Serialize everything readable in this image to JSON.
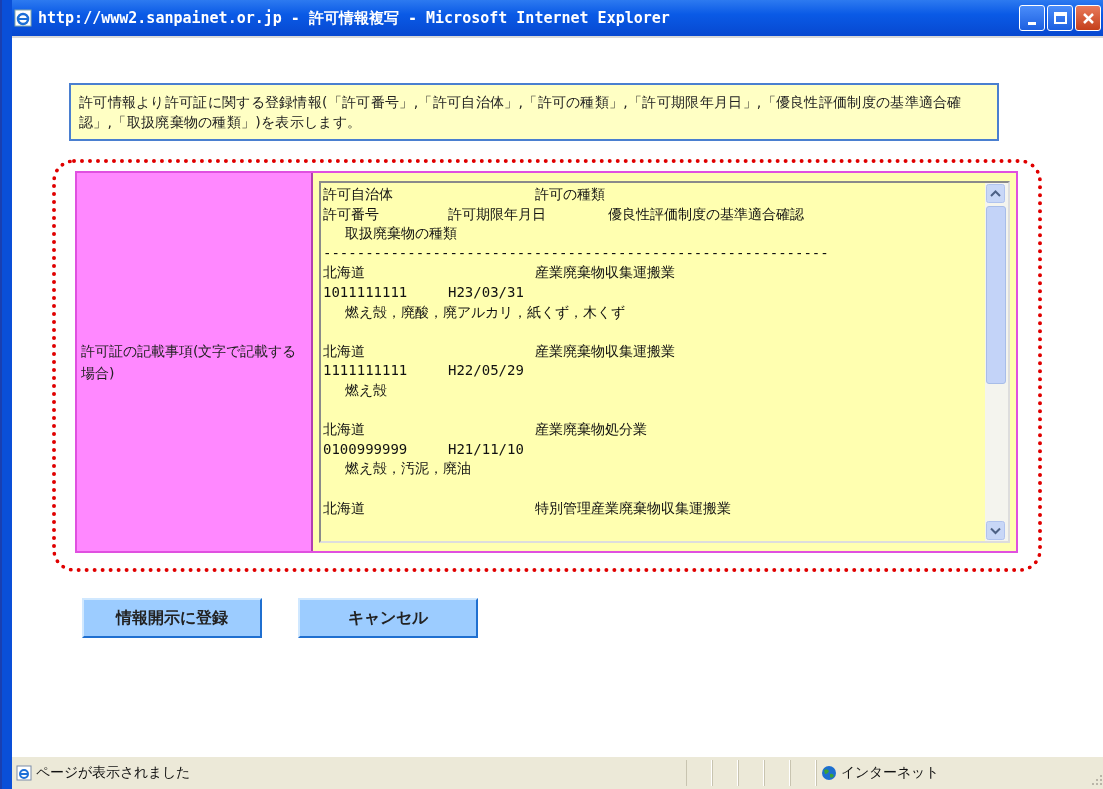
{
  "window": {
    "title": "http://www2.sanpainet.or.jp - 許可情報複写 - Microsoft Internet Explorer"
  },
  "notice": "許可情報より許可証に関する登録情報(「許可番号」,「許可自治体」,「許可の種類」,「許可期限年月日」,「優良性評価制度の基準適合確認」,「取扱廃棄物の種類」)を表示します。",
  "field": {
    "label": "許可証の記載事項(文字で記載する場合)",
    "header": {
      "municipality": "許可自治体",
      "permit_type": "許可の種類",
      "permit_number": "許可番号",
      "expiry": "許可期限年月日",
      "evaluation": "優良性評価制度の基準適合確認",
      "wastes": "取扱廃棄物の種類"
    },
    "separator": "------------------------------------------------------------",
    "records": [
      {
        "municipality": "北海道",
        "permit_type": "産業廃棄物収集運搬業",
        "permit_number": "1011111111",
        "expiry": "H23/03/31",
        "wastes": "燃え殻，廃酸，廃アルカリ，紙くず，木くず"
      },
      {
        "municipality": "北海道",
        "permit_type": "産業廃棄物収集運搬業",
        "permit_number": "1111111111",
        "expiry": "H22/05/29",
        "wastes": "燃え殻"
      },
      {
        "municipality": "北海道",
        "permit_type": "産業廃棄物処分業",
        "permit_number": "0100999999",
        "expiry": "H21/11/10",
        "wastes": "燃え殻，汚泥，廃油"
      },
      {
        "municipality": "北海道",
        "permit_type": "特別管理産業廃棄物収集運搬業"
      }
    ]
  },
  "buttons": [
    "情報開示に登録",
    "キャンセル"
  ],
  "status_bar": {
    "message": "ページが表示されました",
    "zone": "インターネット"
  }
}
